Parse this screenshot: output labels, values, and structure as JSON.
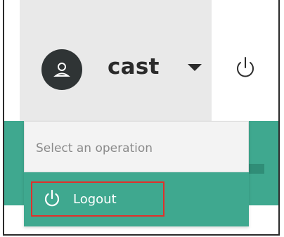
{
  "header": {
    "username": "cast",
    "avatar_icon": "user-icon",
    "caret_icon": "caret-down-icon",
    "power_icon": "power-icon"
  },
  "dropdown": {
    "header_text": "Select an operation",
    "items": [
      {
        "label": "Logout",
        "icon": "power-icon"
      }
    ]
  },
  "colors": {
    "header_bg": "#e9e9e9",
    "avatar_bg": "#2f3435",
    "accent_green": "#3fa88f",
    "highlight_border": "#e0312b"
  }
}
